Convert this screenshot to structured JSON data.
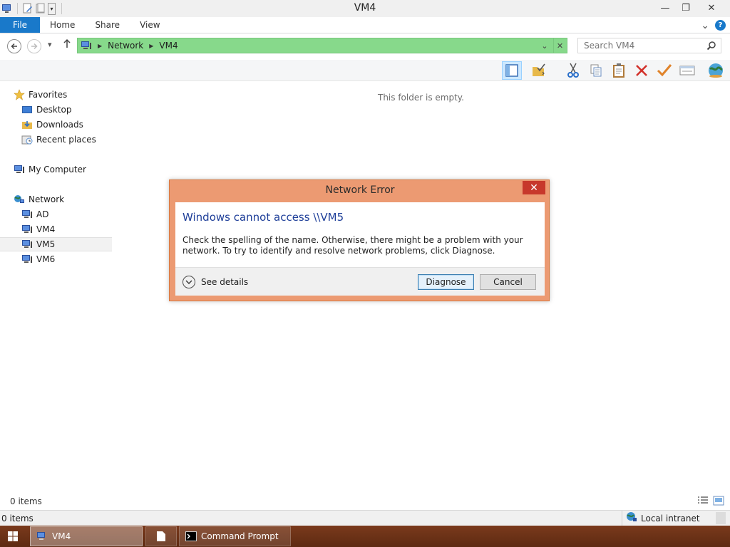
{
  "window": {
    "title": "VM4",
    "minimize_glyph": "—",
    "restore_glyph": "❐",
    "close_glyph": "✕"
  },
  "ribbon": {
    "tabs": [
      "File",
      "Home",
      "Share",
      "View"
    ],
    "expand_glyph": "⌄",
    "help_glyph": "?"
  },
  "address": {
    "crumbs": [
      "Network",
      "VM4"
    ],
    "dropdown_glyph": "⌄",
    "clear_glyph": "✕",
    "bg_color": "#87d98b"
  },
  "search": {
    "placeholder": "Search VM4"
  },
  "navpane": {
    "favorites": "Favorites",
    "desktop": "Desktop",
    "downloads": "Downloads",
    "recent": "Recent places",
    "my_computer": "My Computer",
    "network": "Network",
    "hosts": [
      "AD",
      "VM4",
      "VM5",
      "VM6"
    ]
  },
  "content": {
    "empty_message": "This folder is empty."
  },
  "status": {
    "items_count": "0 items",
    "items_count_bottom": "0 items",
    "zone": "Local intranet"
  },
  "taskbar": {
    "tasks": [
      "VM4",
      "Command Prompt"
    ]
  },
  "dialog": {
    "title": "Network Error",
    "close_glyph": "✕",
    "heading": "Windows cannot access \\\\VM5",
    "message": "Check the spelling of the name. Otherwise, there might be a problem with your network. To try to identify and resolve network problems, click Diagnose.",
    "details_label": "See details",
    "diagnose_label": "Diagnose",
    "cancel_label": "Cancel",
    "border_color": "#ec9a72",
    "heading_color": "#1f3f99"
  }
}
